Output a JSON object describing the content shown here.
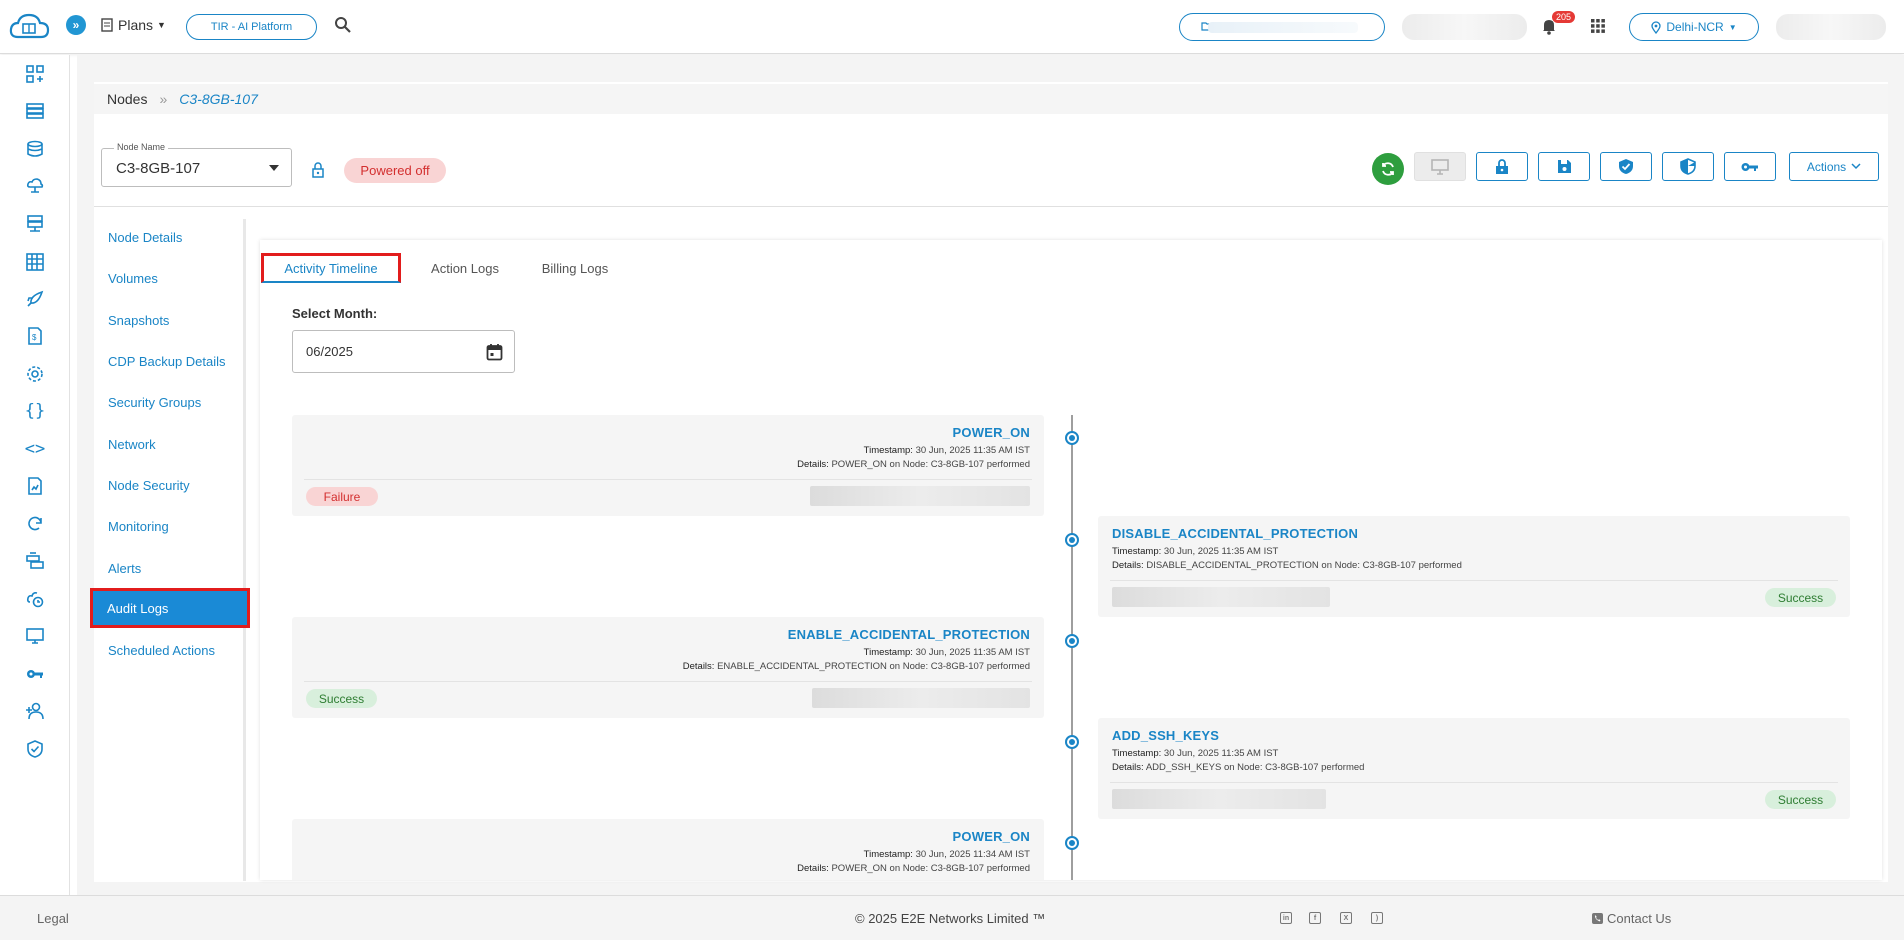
{
  "topbar": {
    "plans_label": "Plans",
    "tir_label": "TIR - AI Platform",
    "notification_count": "205",
    "region_label": "Delhi-NCR"
  },
  "breadcrumb": {
    "root": "Nodes",
    "separator": "»",
    "current": "C3-8GB-107"
  },
  "node": {
    "field_label": "Node Name",
    "name": "C3-8GB-107",
    "status": "Powered off"
  },
  "toolbar": {
    "actions_label": "Actions"
  },
  "leftnav": {
    "items": [
      {
        "label": "Node Details"
      },
      {
        "label": "Volumes"
      },
      {
        "label": "Snapshots"
      },
      {
        "label": "CDP Backup Details"
      },
      {
        "label": "Security Groups"
      },
      {
        "label": "Network"
      },
      {
        "label": "Node Security"
      },
      {
        "label": "Monitoring"
      },
      {
        "label": "Alerts"
      },
      {
        "label": "Audit Logs"
      },
      {
        "label": "Scheduled Actions"
      }
    ],
    "active_index": 9
  },
  "tabs": [
    {
      "label": "Activity Timeline"
    },
    {
      "label": "Action Logs"
    },
    {
      "label": "Billing Logs"
    }
  ],
  "month_picker": {
    "label": "Select Month:",
    "value": "06/2025"
  },
  "timeline": {
    "ts_label": "Timestamp:",
    "details_label": "Details:",
    "events": [
      {
        "title": "POWER_ON",
        "timestamp": "30 Jun, 2025 11:35 AM IST",
        "details": "POWER_ON on Node: C3-8GB-107 performed",
        "status": "Failure",
        "side": "left"
      },
      {
        "title": "DISABLE_ACCIDENTAL_PROTECTION",
        "timestamp": "30 Jun, 2025 11:35 AM IST",
        "details": "DISABLE_ACCIDENTAL_PROTECTION on Node: C3-8GB-107 performed",
        "status": "Success",
        "side": "right"
      },
      {
        "title": "ENABLE_ACCIDENTAL_PROTECTION",
        "timestamp": "30 Jun, 2025 11:35 AM IST",
        "details": "ENABLE_ACCIDENTAL_PROTECTION on Node: C3-8GB-107 performed",
        "status": "Success",
        "side": "left"
      },
      {
        "title": "ADD_SSH_KEYS",
        "timestamp": "30 Jun, 2025 11:35 AM IST",
        "details": "ADD_SSH_KEYS on Node: C3-8GB-107 performed",
        "status": "Success",
        "side": "right"
      },
      {
        "title": "POWER_ON",
        "timestamp": "30 Jun, 2025 11:34 AM IST",
        "details": "POWER_ON on Node: C3-8GB-107 performed",
        "status": "",
        "side": "left"
      }
    ]
  },
  "footer": {
    "legal": "Legal",
    "copyright": "© 2025 E2E Networks Limited ™",
    "contact": "Contact Us",
    "social": [
      {
        "icon": "linkedin-icon",
        "glyph": "in"
      },
      {
        "icon": "facebook-icon",
        "glyph": "f"
      },
      {
        "icon": "x-twitter-icon",
        "glyph": "X"
      },
      {
        "icon": "rss-icon",
        "glyph": ")"
      }
    ]
  },
  "colors": {
    "accent": "#1a85c6",
    "highlight_outline": "#e21c1c",
    "failure": "#d32f2f",
    "success": "#2e7d32",
    "refresh_green": "#2e9e3e"
  }
}
